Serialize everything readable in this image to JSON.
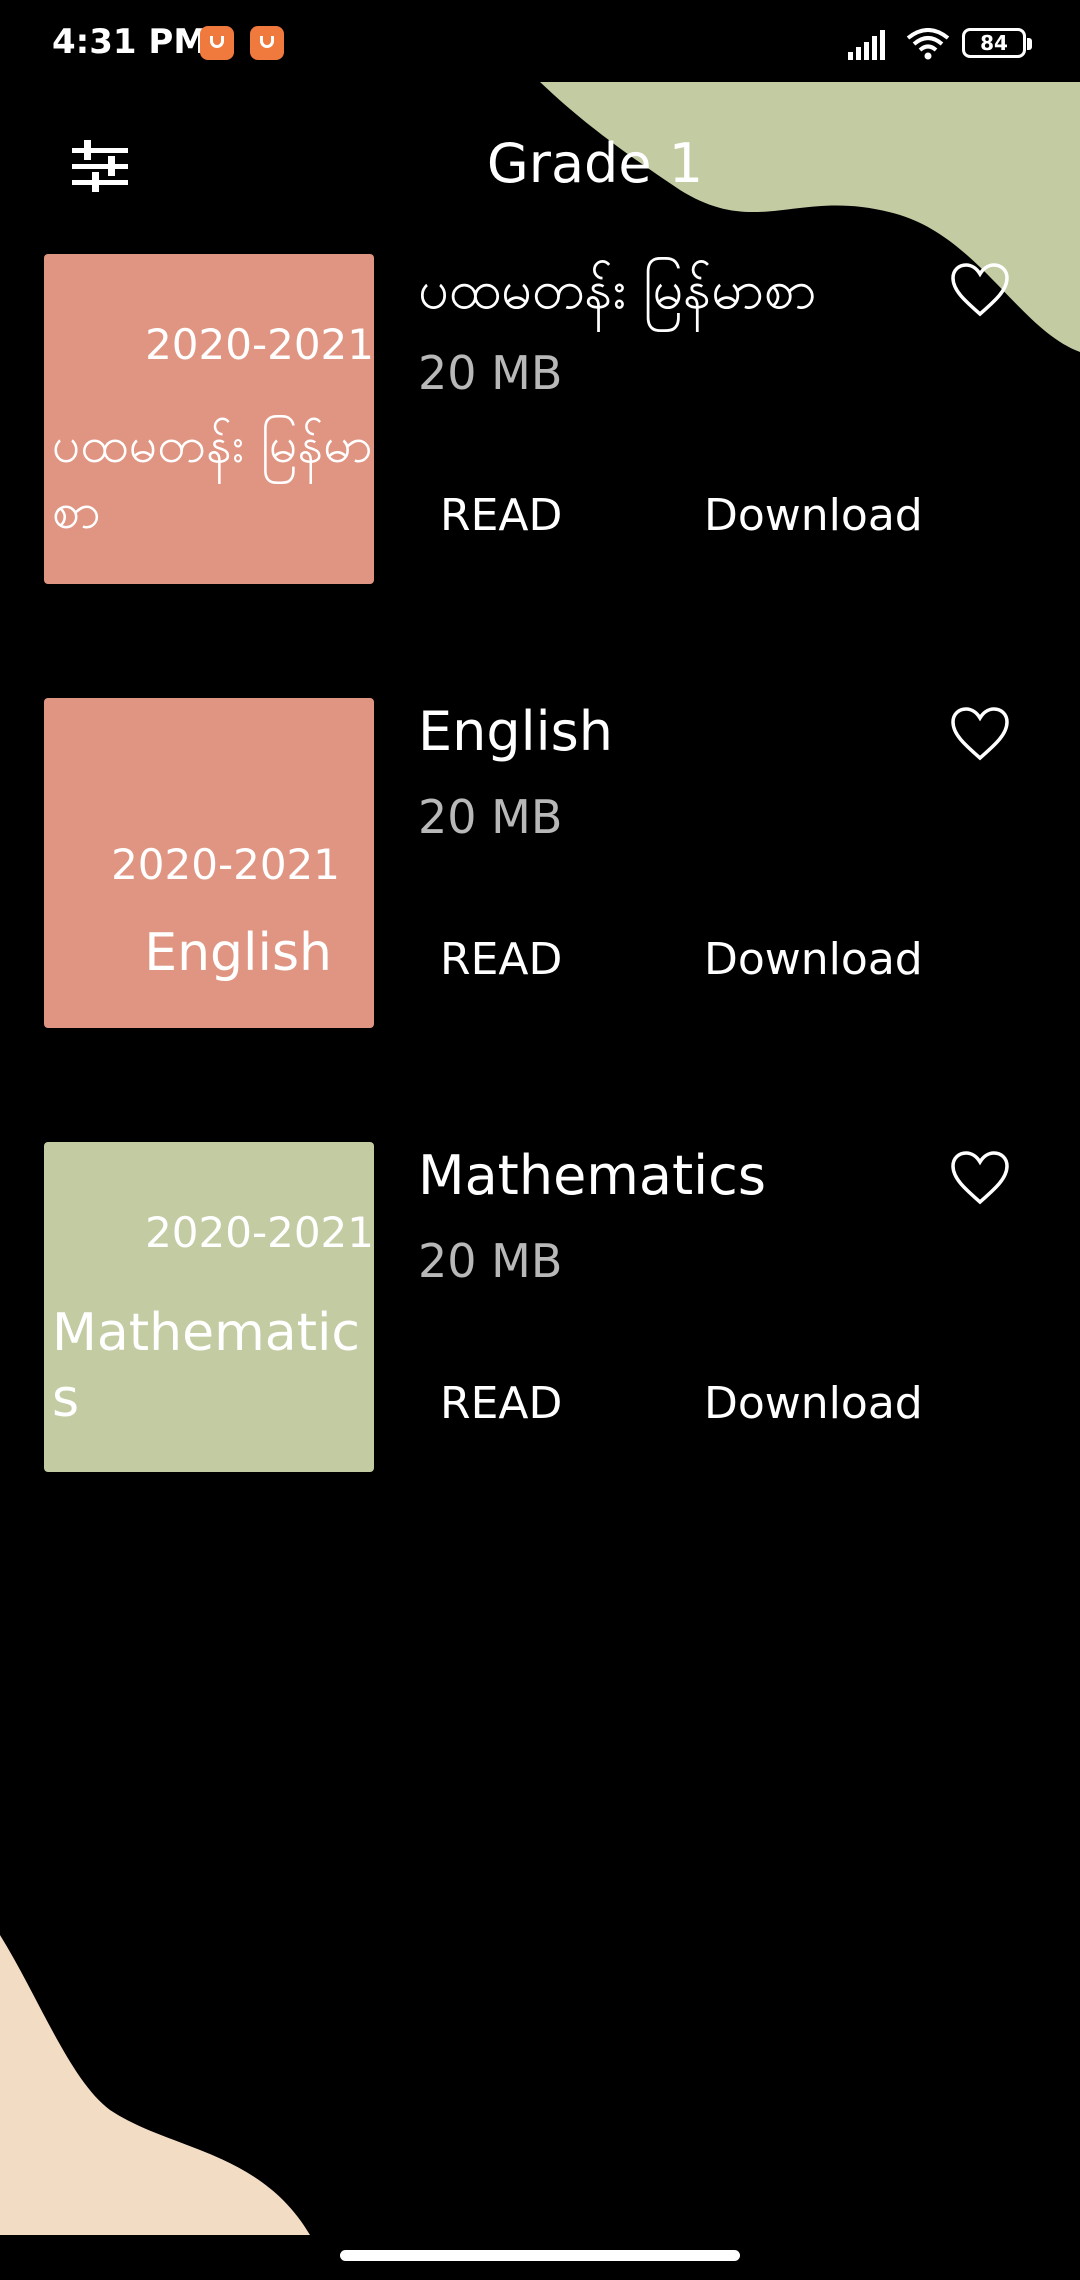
{
  "status_bar": {
    "time": "4:31 PM",
    "notification_icons": [
      "app-notification-icon",
      "app-notification-icon"
    ],
    "signal_icon": "signal-icon",
    "wifi_icon": "wifi-icon",
    "battery": "84"
  },
  "header": {
    "title": "Grade 1",
    "filter_icon": "filter-sliders-icon"
  },
  "colors": {
    "background": "#000000",
    "cover_salmon": "#e09582",
    "cover_sage": "#c2cba2",
    "shape_top_right": "#c2cba2",
    "shape_bottom_left": "#f2dcc4",
    "size_text": "#b8b8b8"
  },
  "books": [
    {
      "cover_year": "2020-2021",
      "cover_title": "ပထမတန်း မြန်မာစာ",
      "title": "ပထမတန်း မြန်မာစာ",
      "size": "20 MB",
      "read_label": "READ",
      "download_label": "Download",
      "favorite_icon": "heart-outline-icon"
    },
    {
      "cover_year": "2020-2021",
      "cover_title": "English",
      "title": "English",
      "size": "20 MB",
      "read_label": "READ",
      "download_label": "Download",
      "favorite_icon": "heart-outline-icon"
    },
    {
      "cover_year": "2020-2021",
      "cover_title": "Mathematics",
      "title": "Mathematics",
      "size": "20 MB",
      "read_label": "READ",
      "download_label": "Download",
      "favorite_icon": "heart-outline-icon"
    }
  ]
}
